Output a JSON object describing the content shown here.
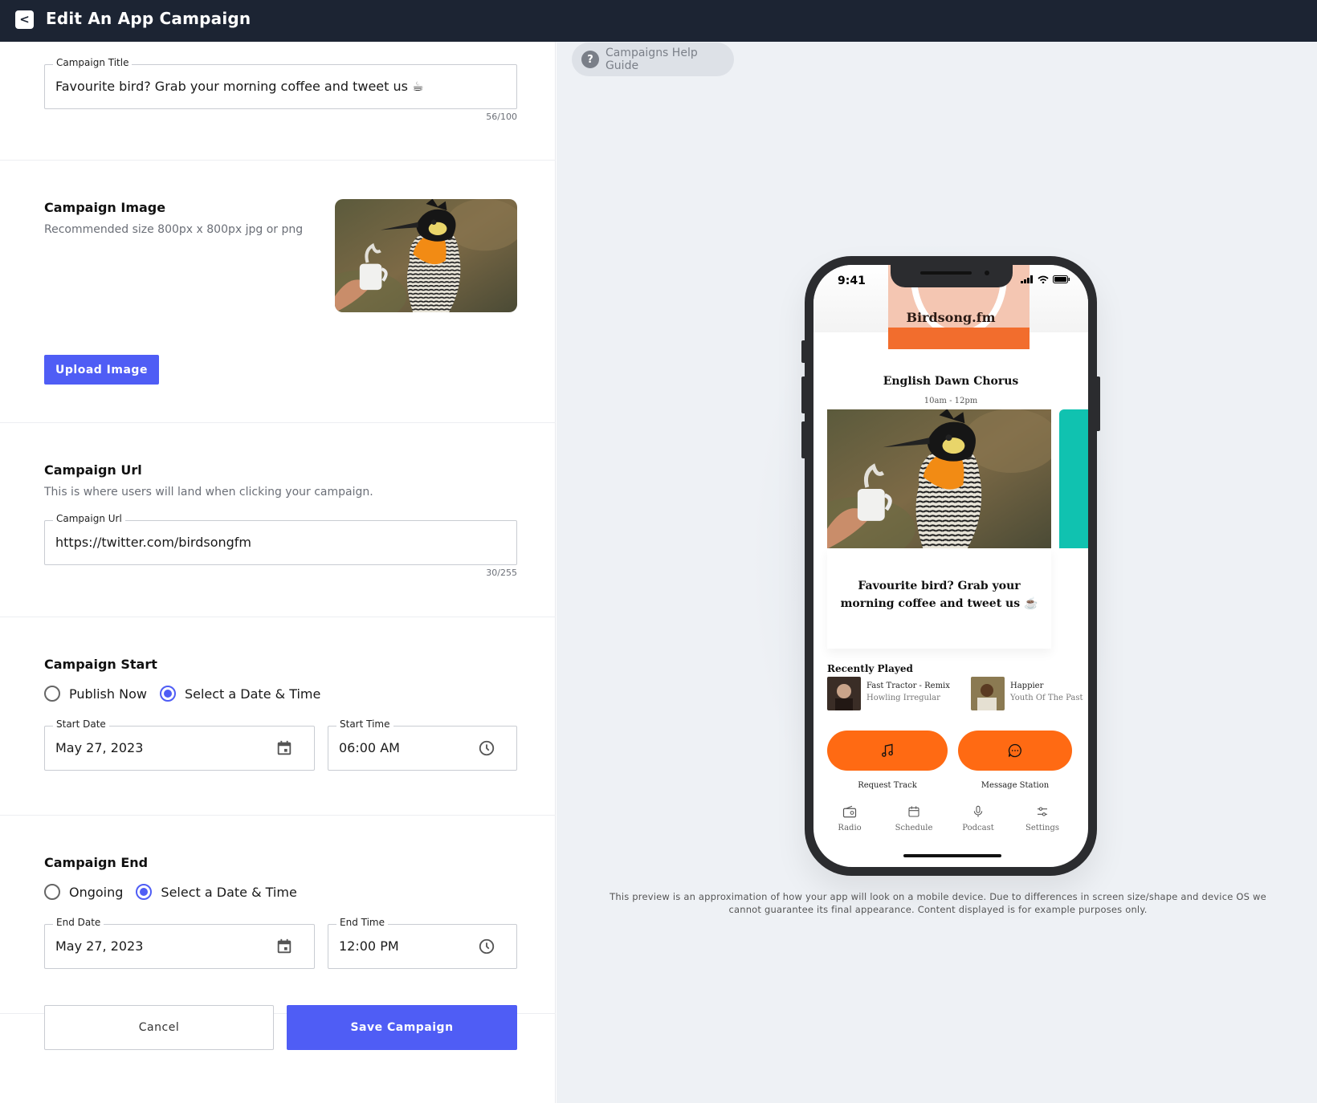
{
  "header": {
    "title": "Edit An App Campaign",
    "back_icon": "chevron-left-icon"
  },
  "form": {
    "title_field": {
      "label": "Campaign Title",
      "value": "Favourite bird? Grab your morning coffee and tweet us ☕",
      "counter": "56/100"
    },
    "image_section": {
      "title": "Campaign Image",
      "subtitle": "Recommended size 800px x 800px jpg or png",
      "upload_label": "Upload Image"
    },
    "url_section": {
      "title": "Campaign Url",
      "subtitle": "This is where users will land when clicking your campaign.",
      "field_label": "Campaign Url",
      "value": "https://twitter.com/birdsongfm",
      "counter": "30/255"
    },
    "start_section": {
      "title": "Campaign Start",
      "options": [
        "Publish Now",
        "Select a Date & Time"
      ],
      "selected": "Select a Date & Time",
      "date_label": "Start Date",
      "date_value": "May 27, 2023",
      "time_label": "Start Time",
      "time_value": "06:00 AM"
    },
    "end_section": {
      "title": "Campaign End",
      "options": [
        "Ongoing",
        "Select a Date & Time"
      ],
      "selected": "Select a Date & Time",
      "date_label": "End Date",
      "date_value": "May 27, 2023",
      "time_label": "End Time",
      "time_value": "12:00 PM"
    },
    "cancel_label": "Cancel",
    "save_label": "Save Campaign"
  },
  "preview": {
    "help_label": "Campaigns Help Guide",
    "phone": {
      "time": "9:41",
      "station_name": "Birdsong.fm",
      "show_title": "English Dawn Chorus",
      "show_time": "10am - 12pm",
      "campaign_text": "Favourite bird? Grab your morning coffee and tweet us ☕",
      "recently_played_title": "Recently Played",
      "recent": [
        {
          "track": "Fast Tractor - Remix",
          "artist": "Howling Irregular"
        },
        {
          "track": "Happier",
          "artist": "Youth Of The Past"
        }
      ],
      "actions": [
        {
          "label": "Request Track",
          "icon": "music-note-icon"
        },
        {
          "label": "Message Station",
          "icon": "chat-bubble-icon"
        }
      ],
      "tabs": [
        {
          "label": "Radio",
          "icon": "radio-icon"
        },
        {
          "label": "Schedule",
          "icon": "calendar-icon"
        },
        {
          "label": "Podcast",
          "icon": "microphone-icon"
        },
        {
          "label": "Settings",
          "icon": "sliders-icon"
        }
      ]
    },
    "disclaimer": "This preview is an approximation of how your app will look on a mobile device. Due to differences in screen size/shape and device OS we cannot guarantee its final appearance. Content displayed is for example purposes only."
  },
  "colors": {
    "accent": "#4f5df5",
    "header_bg": "#1c2433",
    "preview_orange": "#ff6a13",
    "preview_teal": "#10c2b0"
  }
}
